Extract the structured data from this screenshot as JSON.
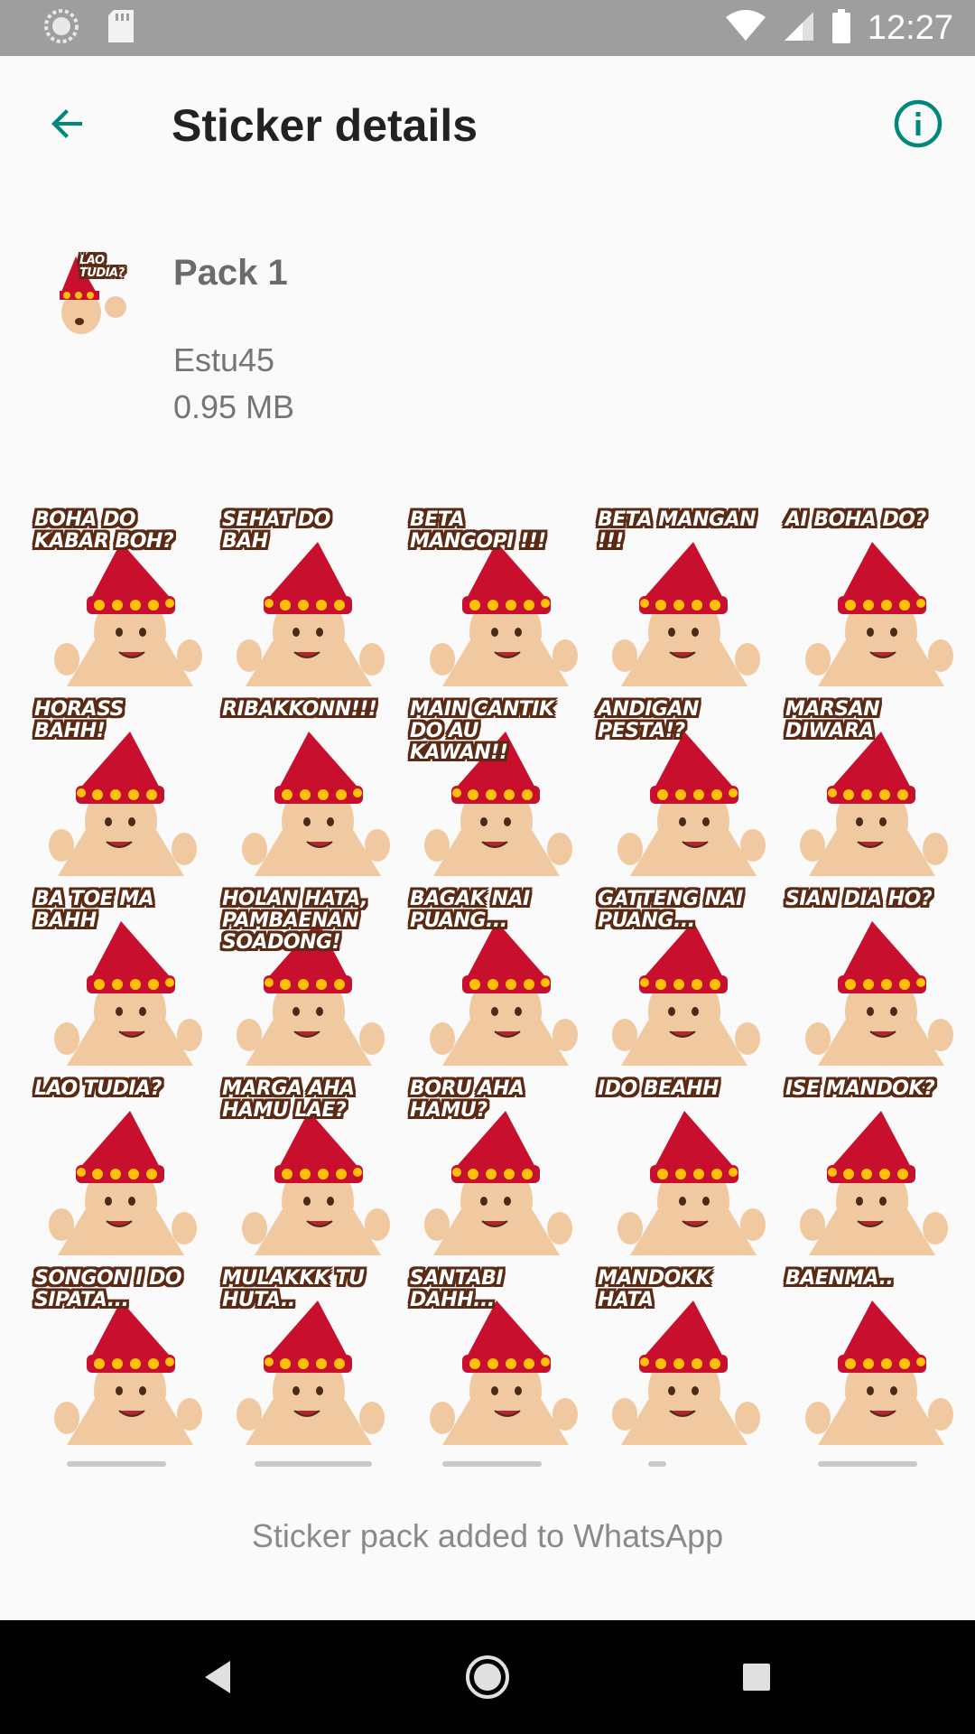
{
  "status_bar": {
    "time": "12:27",
    "icons": [
      "notification-circle-icon",
      "sd-card-icon",
      "wifi-icon",
      "cell-signal-icon",
      "battery-icon"
    ]
  },
  "toolbar": {
    "back_icon": "arrow-back-icon",
    "title": "Sticker details",
    "info_icon": "info-icon",
    "accent": "#00897b"
  },
  "pack": {
    "tray_caption": "LAO TUDIA?",
    "name": "Pack 1",
    "publisher": "Estu45",
    "size": "0.95 MB"
  },
  "stickers": [
    [
      "BOHA DO KABAR BOH?",
      "SEHAT DO BAH",
      "BETA MANGOPI !!!",
      "BETA MANGAN !!!",
      "AI BOHA DO?"
    ],
    [
      "HORASS BAHH!",
      "RIBAKKONN!!!",
      "MAIN CANTIK DO AU KAWAN!!",
      "ANDIGAN PESTA!?",
      "MARSAN DIWARA"
    ],
    [
      "BA TOE MA BAHH",
      "HOLAN HATA, PAMBAENAN SOADONG!",
      "BAGAK NAI PUANG...",
      "GATTENG NAI PUANG...",
      "SIAN DIA HO?"
    ],
    [
      "LAO TUDIA?",
      "MARGA AHA HAMU LAE?",
      "BORU AHA HAMU?",
      "IDO BEAHH",
      "ISE MANDOK?"
    ],
    [
      "SONGON I DO SIPATA...",
      "MULAKKK TU HUTA..",
      "SANTABI DAHH...",
      "MANDOKK HATA",
      "BAENMA.."
    ]
  ],
  "footer": {
    "status": "Sticker pack added to WhatsApp"
  },
  "nav": {
    "back": "nav-back-icon",
    "home": "nav-home-icon",
    "recents": "nav-recents-icon"
  }
}
